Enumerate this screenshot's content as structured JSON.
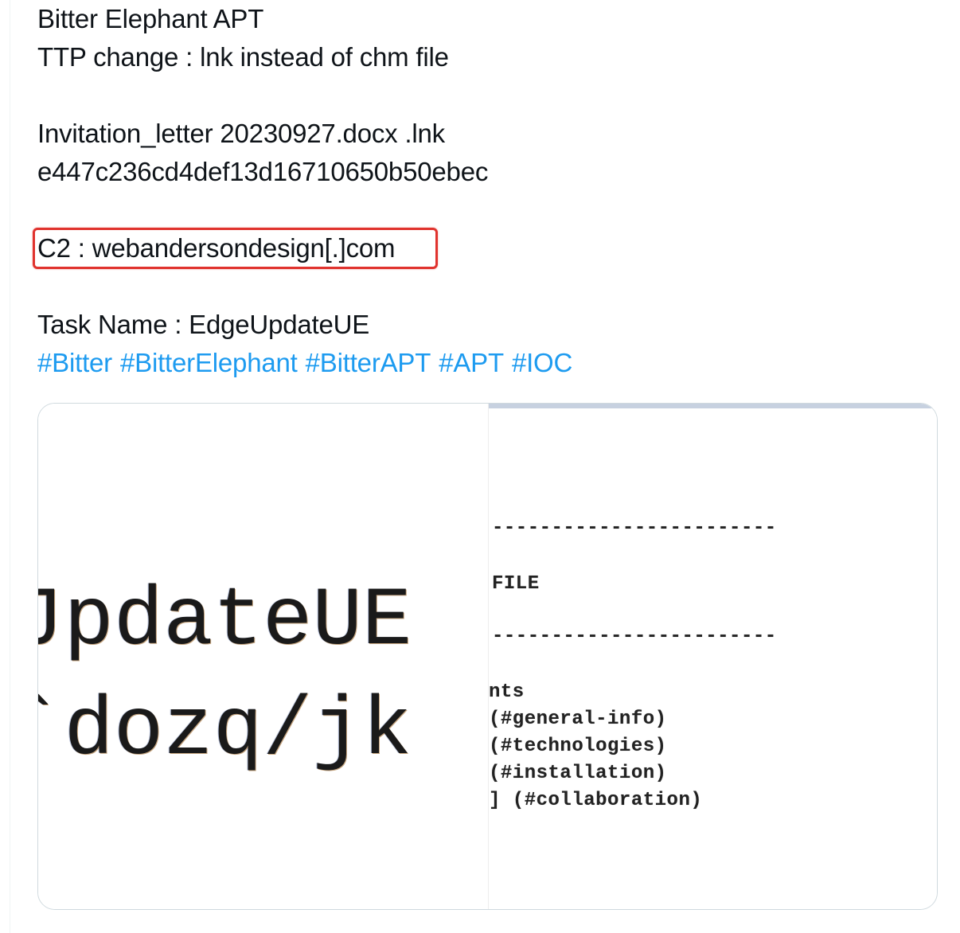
{
  "tweet": {
    "lines": [
      "Bitter Elephant APT",
      "TTP change : lnk instead of chm file",
      "Invitation_letter 20230927.docx .lnk",
      "e447c236cd4def13d16710650b50ebec",
      "C2 : webandersondesign[.]com",
      "Task Name : EdgeUpdateUE"
    ],
    "hashtags": [
      "#Bitter",
      "#BitterElephant",
      "#BitterAPT",
      "#APT",
      "#IOC"
    ]
  },
  "media": {
    "left_image_lines": [
      "JpdateUE",
      "`dozq/jk"
    ],
    "right_image": {
      "dash_line_1": "------------------------",
      "file_label": "FILE",
      "dash_line_2": "------------------------",
      "toc_lines": [
        "nts",
        " (#general-info)",
        " (#technologies)",
        " (#installation)",
        "] (#collaboration)"
      ]
    }
  },
  "colors": {
    "text": "#0f1419",
    "hashtag": "#1d9bf0",
    "highlight_box": "#e0332e",
    "card_border": "#cfd9de"
  }
}
